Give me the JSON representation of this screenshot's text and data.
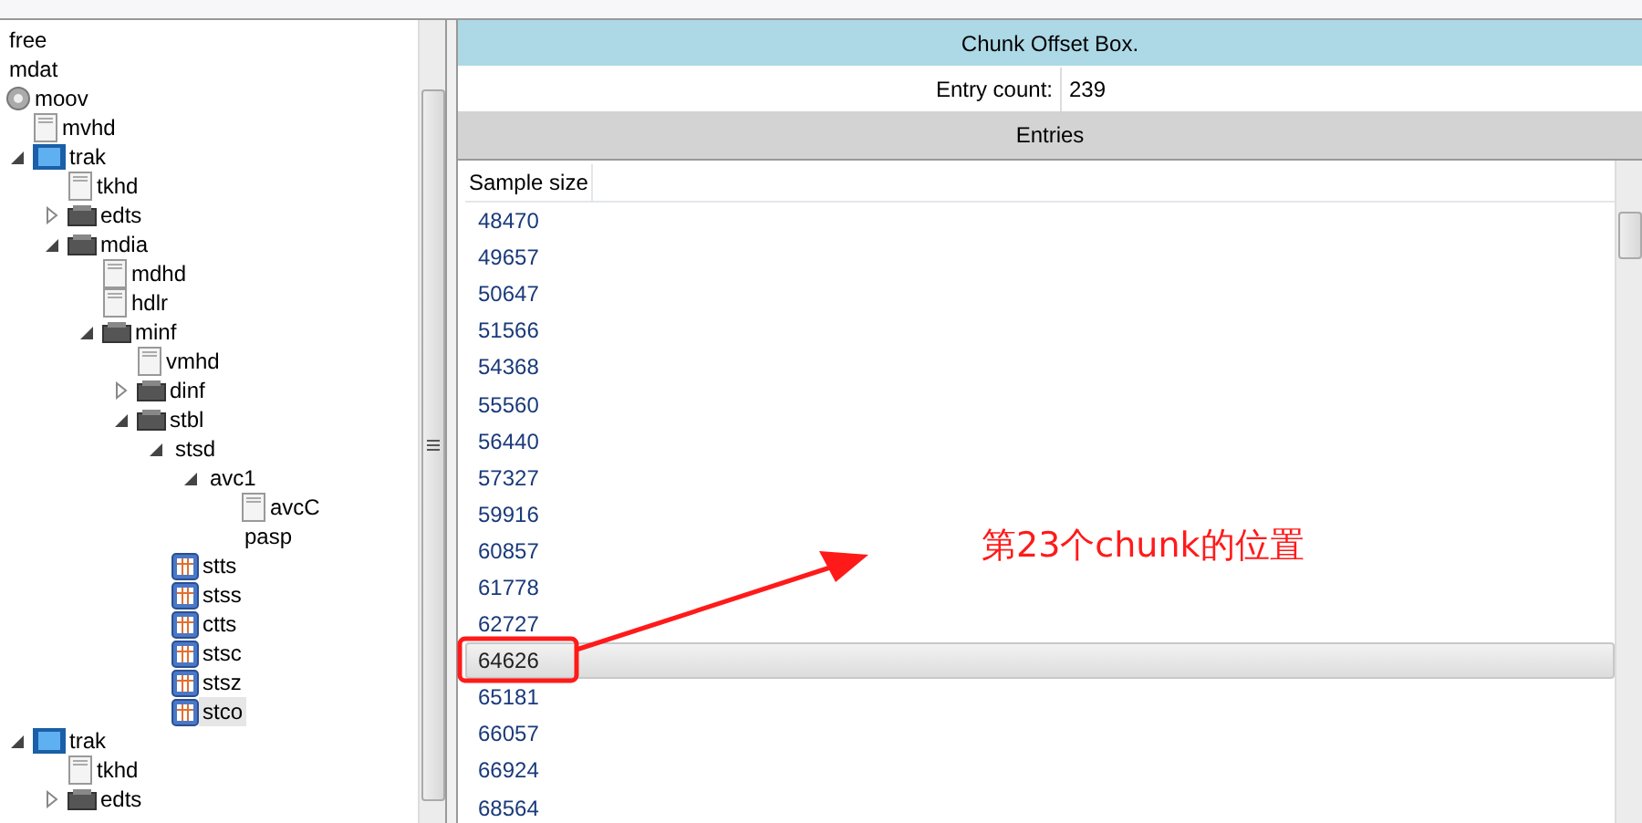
{
  "tree": [
    {
      "label": "free",
      "selected": false
    },
    {
      "label": "mdat",
      "selected": false
    },
    {
      "label": "moov",
      "kind": "gear",
      "selected": false,
      "children": [
        {
          "label": "mvhd",
          "kind": "file",
          "selected": false
        },
        {
          "label": "trak",
          "kind": "film",
          "expanded": true,
          "selected": false,
          "children": [
            {
              "label": "tkhd",
              "kind": "file",
              "selected": false
            },
            {
              "label": "edts",
              "kind": "box",
              "expanded": false,
              "selected": false
            },
            {
              "label": "mdia",
              "kind": "box",
              "expanded": true,
              "selected": false,
              "children": [
                {
                  "label": "mdhd",
                  "kind": "file",
                  "selected": false
                },
                {
                  "label": "hdlr",
                  "kind": "file",
                  "selected": false
                },
                {
                  "label": "minf",
                  "kind": "box",
                  "expanded": true,
                  "selected": false,
                  "children": [
                    {
                      "label": "vmhd",
                      "kind": "file",
                      "selected": false
                    },
                    {
                      "label": "dinf",
                      "kind": "box",
                      "expanded": false,
                      "selected": false
                    },
                    {
                      "label": "stbl",
                      "kind": "box",
                      "expanded": true,
                      "selected": false,
                      "children": [
                        {
                          "label": "stsd",
                          "expanded": true,
                          "selected": false,
                          "children": [
                            {
                              "label": "avc1",
                              "expanded": true,
                              "selected": false,
                              "children": [
                                {
                                  "label": "avcC",
                                  "kind": "file",
                                  "selected": false
                                },
                                {
                                  "label": "pasp",
                                  "selected": false
                                }
                              ]
                            }
                          ]
                        },
                        {
                          "label": "stts",
                          "kind": "table",
                          "selected": false
                        },
                        {
                          "label": "stss",
                          "kind": "table",
                          "selected": false
                        },
                        {
                          "label": "ctts",
                          "kind": "table",
                          "selected": false
                        },
                        {
                          "label": "stsc",
                          "kind": "table",
                          "selected": false
                        },
                        {
                          "label": "stsz",
                          "kind": "table",
                          "selected": false
                        },
                        {
                          "label": "stco",
                          "kind": "table",
                          "selected": true
                        }
                      ]
                    }
                  ]
                }
              ]
            }
          ]
        },
        {
          "label": "trak",
          "kind": "film",
          "expanded": true,
          "selected": false,
          "children": [
            {
              "label": "tkhd",
              "kind": "file",
              "selected": false
            },
            {
              "label": "edts",
              "kind": "box",
              "expanded": false,
              "selected": false
            }
          ]
        }
      ]
    }
  ],
  "panel": {
    "title": "Chunk Offset Box.",
    "entry_count_label": "Entry count:",
    "entry_count": "239",
    "entries_header": "Entries",
    "column": "Sample size",
    "rows": [
      {
        "value": "48470",
        "selected": false
      },
      {
        "value": "49657",
        "selected": false
      },
      {
        "value": "50647",
        "selected": false
      },
      {
        "value": "51566",
        "selected": false
      },
      {
        "value": "54368",
        "selected": false
      },
      {
        "value": "55560",
        "selected": false
      },
      {
        "value": "56440",
        "selected": false
      },
      {
        "value": "57327",
        "selected": false
      },
      {
        "value": "59916",
        "selected": false
      },
      {
        "value": "60857",
        "selected": false
      },
      {
        "value": "61778",
        "selected": false
      },
      {
        "value": "62727",
        "selected": false
      },
      {
        "value": "64626",
        "selected": true
      },
      {
        "value": "65181",
        "selected": false
      },
      {
        "value": "66057",
        "selected": false
      },
      {
        "value": "66924",
        "selected": false
      },
      {
        "value": "68564",
        "selected": false
      }
    ]
  },
  "annotation": {
    "text": "第23个chunk的位置"
  }
}
